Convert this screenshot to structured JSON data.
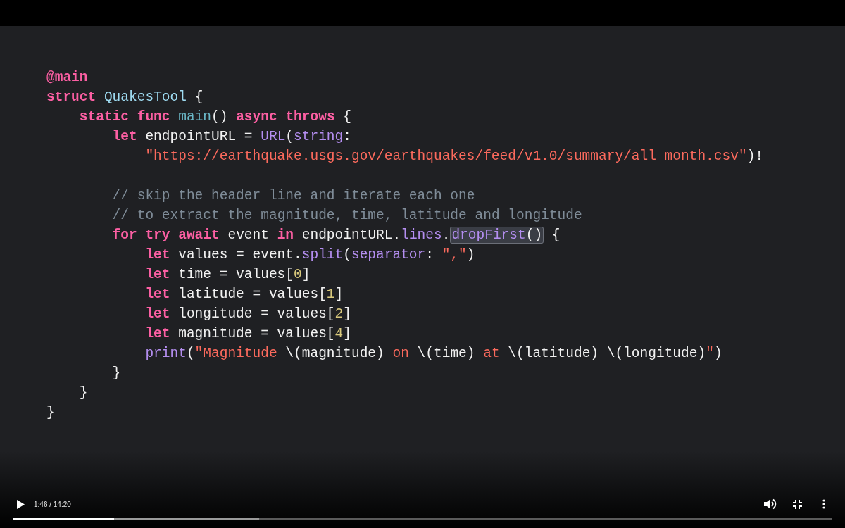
{
  "code": {
    "lines": [
      {
        "tokens": [
          {
            "text": "@main",
            "kind": "keyword"
          }
        ]
      },
      {
        "tokens": [
          {
            "text": "struct ",
            "kind": "keyword"
          },
          {
            "text": "QuakesTool",
            "kind": "type"
          },
          {
            "text": " {",
            "kind": "plain"
          }
        ],
        "children": [
          {
            "tokens": [
              {
                "text": "static ",
                "kind": "keyword"
              },
              {
                "text": "func ",
                "kind": "keyword"
              },
              {
                "text": "main",
                "kind": "decl"
              },
              {
                "text": "() ",
                "kind": "plain"
              },
              {
                "text": "async ",
                "kind": "keyword"
              },
              {
                "text": "throws",
                "kind": "keyword"
              },
              {
                "text": " {",
                "kind": "plain"
              }
            ],
            "children": [
              {
                "tokens": [
                  {
                    "text": "let",
                    "kind": "keyword"
                  },
                  {
                    "text": " endpointURL = ",
                    "kind": "plain"
                  },
                  {
                    "text": "URL",
                    "kind": "api"
                  },
                  {
                    "text": "(",
                    "kind": "plain"
                  },
                  {
                    "text": "string",
                    "kind": "api"
                  },
                  {
                    "text": ":",
                    "kind": "plain"
                  }
                ],
                "children": [
                  {
                    "tokens": [
                      {
                        "text": "\"https://earthquake.usgs.gov/earthquakes/feed/v1.0/summary/all_month.csv\"",
                        "kind": "string"
                      },
                      {
                        "text": ")!",
                        "kind": "plain"
                      }
                    ]
                  }
                ]
              },
              {
                "gap_before": true,
                "tokens": [
                  {
                    "text": "// skip the header line and iterate each one",
                    "kind": "comment"
                  }
                ]
              },
              {
                "tokens": [
                  {
                    "text": "// to extract the magnitude, time, latitude and longitude",
                    "kind": "comment"
                  }
                ]
              },
              {
                "tokens": [
                  {
                    "text": "for ",
                    "kind": "keyword"
                  },
                  {
                    "text": "try ",
                    "kind": "keyword"
                  },
                  {
                    "text": "await",
                    "kind": "keyword"
                  },
                  {
                    "text": " event ",
                    "kind": "plain"
                  },
                  {
                    "text": "in",
                    "kind": "keyword"
                  },
                  {
                    "text": " endpointURL.",
                    "kind": "plain"
                  },
                  {
                    "text": "lines",
                    "kind": "api"
                  },
                  {
                    "text": ".",
                    "kind": "plain"
                  },
                  {
                    "text": "dropFirst",
                    "kind": "api",
                    "highlighted": true
                  },
                  {
                    "text": "()",
                    "kind": "plain",
                    "highlighted": true
                  },
                  {
                    "text": " {",
                    "kind": "plain"
                  }
                ],
                "children": [
                  {
                    "tokens": [
                      {
                        "text": "let",
                        "kind": "keyword"
                      },
                      {
                        "text": " values = event.",
                        "kind": "plain"
                      },
                      {
                        "text": "split",
                        "kind": "api"
                      },
                      {
                        "text": "(",
                        "kind": "plain"
                      },
                      {
                        "text": "separator",
                        "kind": "api"
                      },
                      {
                        "text": ": ",
                        "kind": "plain"
                      },
                      {
                        "text": "\",\"",
                        "kind": "string"
                      },
                      {
                        "text": ")",
                        "kind": "plain"
                      }
                    ]
                  },
                  {
                    "tokens": [
                      {
                        "text": "let",
                        "kind": "keyword"
                      },
                      {
                        "text": " time = values[",
                        "kind": "plain"
                      },
                      {
                        "text": "0",
                        "kind": "number"
                      },
                      {
                        "text": "]",
                        "kind": "plain"
                      }
                    ]
                  },
                  {
                    "tokens": [
                      {
                        "text": "let",
                        "kind": "keyword"
                      },
                      {
                        "text": " latitude = values[",
                        "kind": "plain"
                      },
                      {
                        "text": "1",
                        "kind": "number"
                      },
                      {
                        "text": "]",
                        "kind": "plain"
                      }
                    ]
                  },
                  {
                    "tokens": [
                      {
                        "text": "let",
                        "kind": "keyword"
                      },
                      {
                        "text": " longitude = values[",
                        "kind": "plain"
                      },
                      {
                        "text": "2",
                        "kind": "number"
                      },
                      {
                        "text": "]",
                        "kind": "plain"
                      }
                    ]
                  },
                  {
                    "tokens": [
                      {
                        "text": "let",
                        "kind": "keyword"
                      },
                      {
                        "text": " magnitude = values[",
                        "kind": "plain"
                      },
                      {
                        "text": "4",
                        "kind": "number"
                      },
                      {
                        "text": "]",
                        "kind": "plain"
                      }
                    ]
                  },
                  {
                    "tokens": [
                      {
                        "text": "print",
                        "kind": "api"
                      },
                      {
                        "text": "(",
                        "kind": "plain"
                      },
                      {
                        "text": "\"Magnitude ",
                        "kind": "string"
                      },
                      {
                        "text": "\\(magnitude)",
                        "kind": "plain"
                      },
                      {
                        "text": " on ",
                        "kind": "string"
                      },
                      {
                        "text": "\\(time)",
                        "kind": "plain"
                      },
                      {
                        "text": " at ",
                        "kind": "string"
                      },
                      {
                        "text": "\\(latitude) \\(longitude)",
                        "kind": "plain"
                      },
                      {
                        "text": "\"",
                        "kind": "string"
                      },
                      {
                        "text": ")",
                        "kind": "plain"
                      }
                    ]
                  }
                ]
              },
              {
                "tokens": [
                  {
                    "text": "}",
                    "kind": "plain"
                  }
                ]
              }
            ]
          },
          {
            "tokens": [
              {
                "text": "}",
                "kind": "plain"
              }
            ]
          }
        ]
      },
      {
        "tokens": [
          {
            "text": "}",
            "kind": "plain"
          }
        ]
      }
    ]
  },
  "player": {
    "time": "1:46 / 14:20",
    "progress": {
      "level": 0.123
    },
    "buffer": {
      "level": 0.3
    }
  }
}
